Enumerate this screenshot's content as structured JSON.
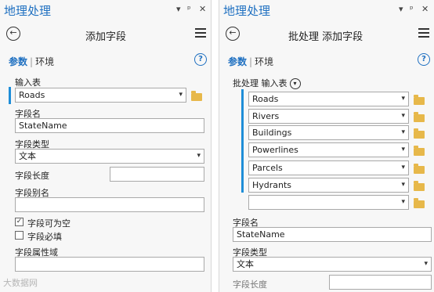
{
  "left": {
    "app_title": "地理处理",
    "window_controls": [
      "▾",
      "ᵖ",
      "✕"
    ],
    "tool_title": "添加字段",
    "tabs": {
      "params": "参数",
      "env": "环境"
    },
    "input_table_label": "输入表",
    "input_table_value": "Roads",
    "field_name_label": "字段名",
    "field_name_value": "StateName",
    "field_type_label": "字段类型",
    "field_type_value": "文本",
    "field_length_label": "字段长度",
    "field_length_value": "",
    "field_alias_label": "字段别名",
    "field_alias_value": "",
    "nullable_label": "字段可为空",
    "nullable_checked": true,
    "required_label": "字段必填",
    "required_checked": false,
    "domain_label": "字段属性域",
    "domain_value": ""
  },
  "right": {
    "app_title": "地理处理",
    "window_controls": [
      "▾",
      "ᵖ",
      "✕"
    ],
    "tool_title": "批处理 添加字段",
    "tabs": {
      "params": "参数",
      "env": "环境"
    },
    "batch_label": "批处理 输入表",
    "batch_items": [
      "Roads",
      "Rivers",
      "Buildings",
      "Powerlines",
      "Parcels",
      "Hydrants",
      ""
    ],
    "field_name_label": "字段名",
    "field_name_value": "StateName",
    "field_type_label": "字段类型",
    "field_type_value": "文本",
    "field_length_label": "字段长度"
  },
  "watermark": "大数据网",
  "icons": {
    "back": "back-arrow-icon",
    "menu": "hamburger-menu-icon",
    "help": "help-icon",
    "folder": "folder-icon",
    "dropdown": "chevron-down-icon"
  },
  "colors": {
    "accent": "#1f70c1",
    "bar": "#1f8ed8",
    "folder": "#e7b84a"
  }
}
